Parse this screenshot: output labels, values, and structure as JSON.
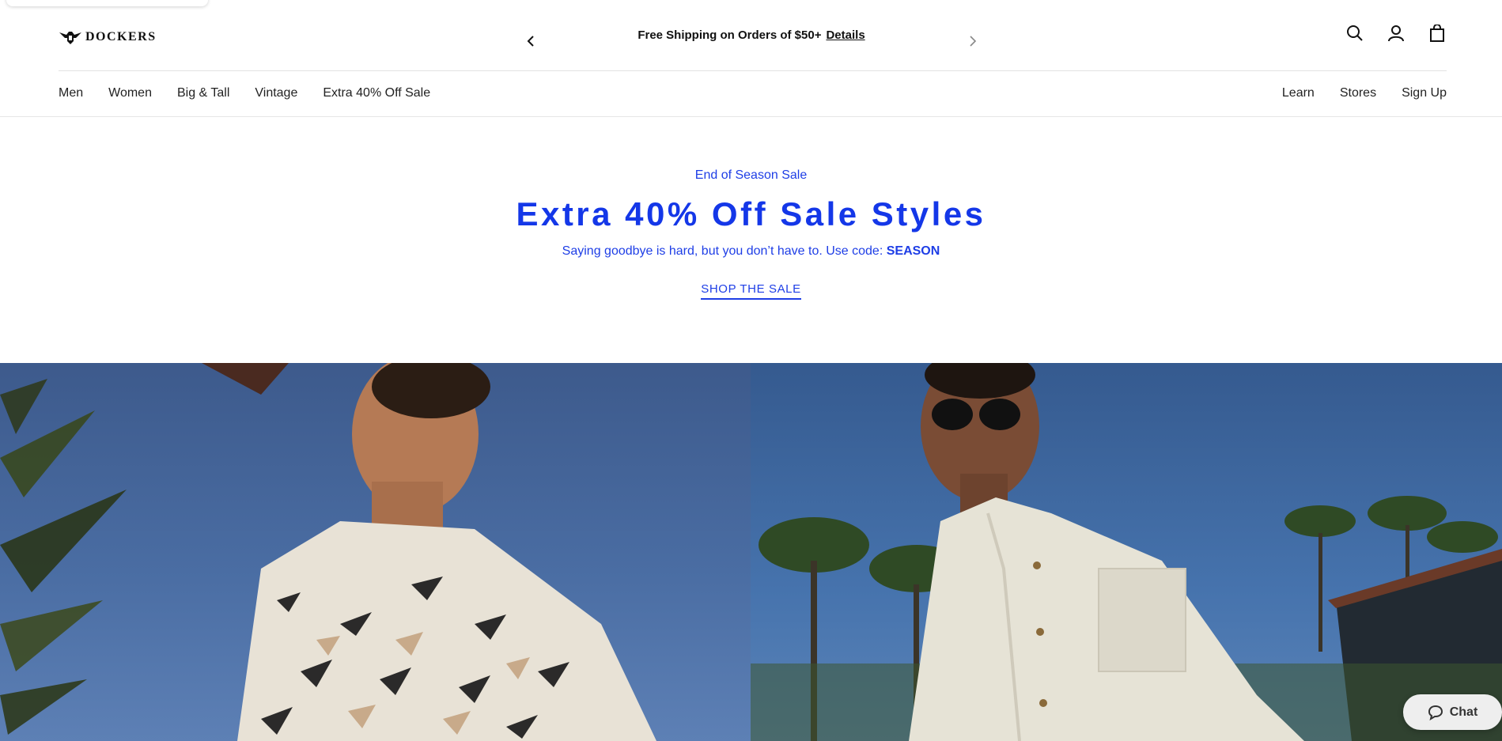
{
  "brand": {
    "name": "DOCKERS"
  },
  "promo": {
    "text": "Free Shipping on Orders of $50+",
    "link": "Details"
  },
  "header_icons": [
    "search-icon",
    "account-icon",
    "bag-icon"
  ],
  "nav": {
    "left": [
      "Men",
      "Women",
      "Big & Tall",
      "Vintage",
      "Extra 40% Off Sale"
    ],
    "right": [
      "Learn",
      "Stores",
      "Sign Up"
    ]
  },
  "hero": {
    "eyebrow": "End of Season Sale",
    "headline": "Extra 40% Off Sale Styles",
    "subline": "Saying goodbye is hard, but you don’t have to. Use code:",
    "code": "SEASON",
    "cta": "SHOP THE SALE"
  },
  "chat": {
    "label": "Chat"
  },
  "colors": {
    "accent": "#1437e8",
    "text": "#1a1a1a"
  }
}
